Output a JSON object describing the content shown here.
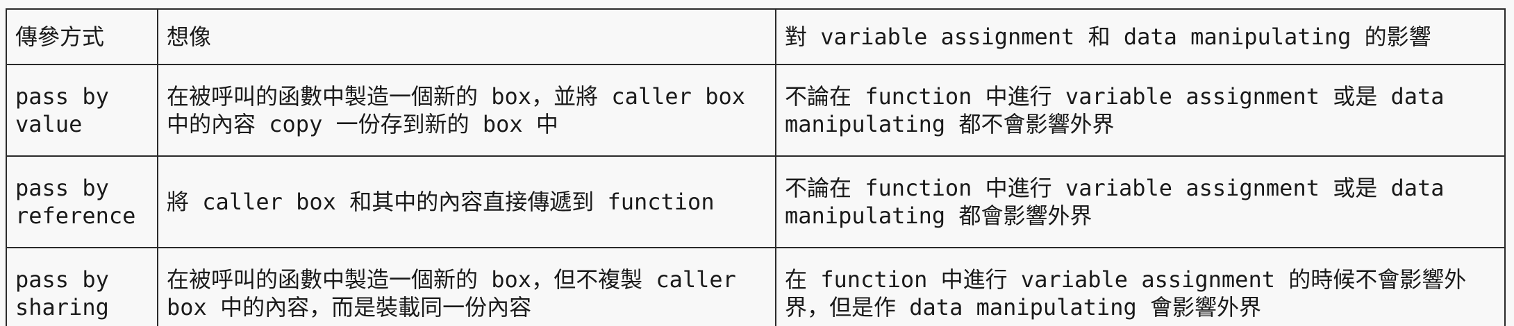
{
  "table": {
    "headers": [
      "傳參方式",
      "想像",
      "對 variable assignment 和 data manipulating 的影響"
    ],
    "rows": [
      {
        "method": "pass by value",
        "imagine": "在被呼叫的函數中製造一個新的 box，並將 caller box 中的內容 copy 一份存到新的 box 中",
        "effect": "不論在 function 中進行 variable assignment 或是 data manipulating 都不會影響外界"
      },
      {
        "method": "pass by reference",
        "imagine": "將 caller box 和其中的內容直接傳遞到 function",
        "effect": "不論在 function 中進行 variable assignment 或是 data manipulating 都會影響外界"
      },
      {
        "method": "pass by sharing",
        "imagine": "在被呼叫的函數中製造一個新的 box，但不複製 caller box 中的內容，而是裝載同一份內容",
        "effect": "在 function 中進行 variable assignment 的時候不會影響外界，但是作 data manipulating 會影響外界"
      }
    ]
  }
}
